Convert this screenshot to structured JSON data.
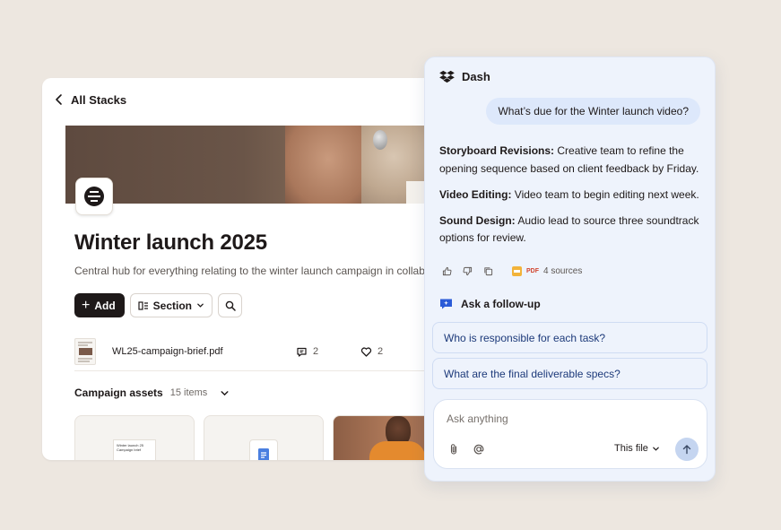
{
  "stack": {
    "back_label": "All Stacks",
    "title": "Winter launch 2025",
    "description": "Central hub for everything relating to the winter launch campaign in collabora",
    "toolbar": {
      "add_label": "Add",
      "section_label": "Section"
    },
    "file": {
      "name": "WL25-campaign-brief.pdf",
      "comments": "2",
      "likes": "2"
    },
    "assets": {
      "title": "Campaign assets",
      "count": "15 items"
    },
    "tile_doc_text": "Winter launch 25 Campaign brief"
  },
  "dash": {
    "title": "Dash",
    "user_question": "What’s due for the Winter launch video?",
    "answer": [
      {
        "label": "Storyboard Revisions:",
        "text": " Creative team to refine the opening sequence based on client feedback by Friday."
      },
      {
        "label": "Video Editing:",
        "text": " Video team to begin editing next week."
      },
      {
        "label": "Sound Design:",
        "text": " Audio lead to source three soundtrack options for review."
      }
    ],
    "sources": {
      "file_type": "PDF",
      "label": "4 sources"
    },
    "followup": {
      "heading": "Ask a follow-up",
      "suggestions": [
        "Who is responsible for each task?",
        "What are the final deliverable specs?"
      ]
    },
    "composer": {
      "placeholder": "Ask anything",
      "value": "",
      "scope_label": "This file"
    }
  },
  "icons": {
    "back": "chevron-left-icon",
    "plus": "plus-icon",
    "section": "section-layout-icon",
    "search": "search-icon",
    "comment": "comment-icon",
    "heart": "heart-icon",
    "dropbox": "dropbox-logo-icon",
    "thumbs_up": "thumbs-up-icon",
    "thumbs_down": "thumbs-down-icon",
    "copy": "copy-icon",
    "followup": "chat-sparkle-icon",
    "attach": "paperclip-icon",
    "mention": "at-icon",
    "send": "arrow-up-icon"
  },
  "colors": {
    "background": "#ede7e0",
    "ink": "#1e1919",
    "dash_panel": "#eef3fc",
    "user_bubble": "#dde8fb",
    "chip_text": "#1d3a7a",
    "send_button": "#c5d5f0"
  }
}
